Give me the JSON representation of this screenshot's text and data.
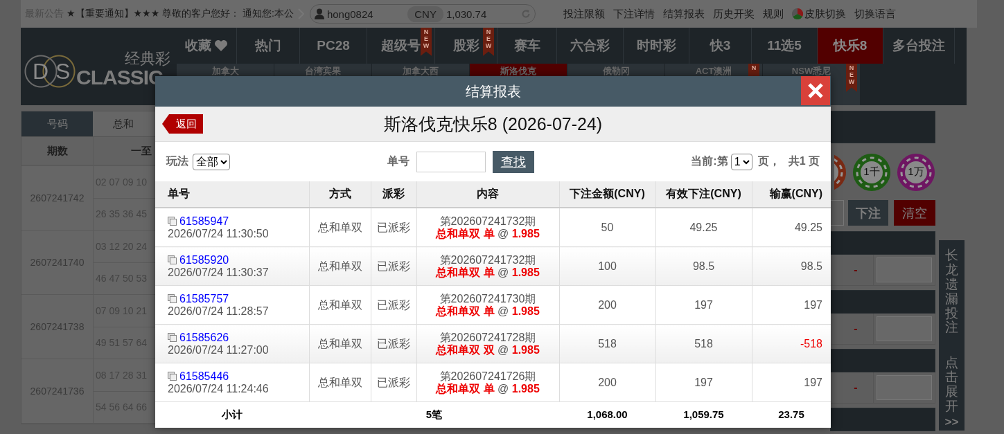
{
  "notice": {
    "label": "最新公告",
    "text": "★【重要通知】★★★ 尊敬的客户您好： 通知您:本公"
  },
  "account": {
    "username": "hong0824",
    "currency": "CNY",
    "balance": "1,030.74"
  },
  "top_links": [
    {
      "label": "投注限额",
      "kind": "link"
    },
    {
      "label": "下注详情",
      "kind": "link"
    },
    {
      "label": "结算报表",
      "kind": "link"
    },
    {
      "label": "历史开奖",
      "kind": "link"
    },
    {
      "label": "规则",
      "kind": "link"
    },
    {
      "label": "皮肤切换",
      "kind": "skin"
    },
    {
      "label": "切换语言",
      "kind": "link"
    }
  ],
  "logo": {
    "monogram": "DS",
    "title": "经典彩",
    "wordmark": "CLASSIC"
  },
  "nav": [
    {
      "label": "收藏",
      "kind": "favorite",
      "selected": false
    },
    {
      "label": "热门",
      "kind": "plain",
      "selected": false
    },
    {
      "label": "PC28",
      "kind": "plain",
      "selected": false
    },
    {
      "label": "超级号",
      "kind": "plain",
      "selected": false,
      "badge": "NEW"
    },
    {
      "label": "股彩",
      "kind": "plain",
      "selected": false,
      "badge": "NEW"
    },
    {
      "label": "赛车",
      "kind": "plain",
      "selected": false
    },
    {
      "label": "六合彩",
      "kind": "plain",
      "selected": false
    },
    {
      "label": "时时彩",
      "kind": "plain",
      "selected": false
    },
    {
      "label": "快3",
      "kind": "plain",
      "selected": false
    },
    {
      "label": "11选5",
      "kind": "plain",
      "selected": false
    },
    {
      "label": "快乐8",
      "kind": "plain",
      "selected": true
    },
    {
      "label": "多台投注",
      "kind": "plain",
      "selected": false
    }
  ],
  "sub_nav": [
    {
      "label": "加拿大",
      "selected": false
    },
    {
      "label": "台湾宾果",
      "selected": false
    },
    {
      "label": "加拿大西",
      "selected": false
    },
    {
      "label": "斯洛伐克",
      "selected": true
    },
    {
      "label": "俄勒冈",
      "selected": false
    },
    {
      "label": "ACT澳洲",
      "selected": false,
      "badge": "N"
    },
    {
      "label": "NSW悉尼",
      "selected": false,
      "badge": "NEW"
    }
  ],
  "history": {
    "tabs": [
      {
        "label": "号码",
        "selected": true
      },
      {
        "label": "总和",
        "selected": false
      }
    ],
    "columns": [
      "期数",
      "一至"
    ],
    "rows": [
      {
        "issue": "2607241742",
        "lines": [
          "02 07 09 10",
          "26 35 36 45"
        ]
      },
      {
        "issue": "2607241740",
        "lines": [
          "03 12 20 24",
          "46 47 50 53"
        ]
      },
      {
        "issue": "2607241738",
        "lines": [
          "07 09 10 21",
          "49 51 57 64"
        ]
      },
      {
        "issue": "2607241736",
        "lines": [
          "08 17 28 31",
          "54 56 64 66"
        ]
      }
    ]
  },
  "bet_panel": {
    "chips": [
      {
        "color": "#7a2a14"
      },
      {
        "label": "1千",
        "color": "#1e5c14"
      },
      {
        "label": "1万",
        "color": "#6e1662"
      }
    ],
    "submit": "下注",
    "clear": "清空",
    "rows": [
      {
        "odds": "-"
      },
      {
        "odds": "-"
      },
      {
        "odds": "-"
      }
    ]
  },
  "side_panel": {
    "title": "长龙遗漏投注",
    "action": "点击展开",
    "arrow": ">>"
  },
  "modal": {
    "title": "结算报表",
    "back": "返回",
    "heading": "斯洛伐克快乐8 (2026-07-24)",
    "filter": {
      "label": "玩法",
      "value": "全部"
    },
    "search": {
      "label": "单号",
      "button": "查找"
    },
    "pager": {
      "before": "当前:第",
      "page": "1",
      "after": "页，",
      "total": "共1 页"
    },
    "columns": [
      "单号",
      "方式",
      "派彩",
      "内容",
      "下注金额(CNY)",
      "有效下注(CNY)",
      "输赢(CNY)"
    ],
    "rows": [
      {
        "order_no": "61585947",
        "time": "2026/07/24 11:30:50",
        "method": "总和单双",
        "payout": "已派彩",
        "period": "第202607241732期",
        "content": "**总和单双 单** @ **1.985**",
        "amount": "50",
        "valid": "49.25",
        "win": "49.25",
        "negative": false
      },
      {
        "order_no": "61585920",
        "time": "2026/07/24 11:30:37",
        "method": "总和单双",
        "payout": "已派彩",
        "period": "第202607241732期",
        "content": "**总和单双 单** @ **1.985**",
        "amount": "100",
        "valid": "98.5",
        "win": "98.5",
        "negative": false
      },
      {
        "order_no": "61585757",
        "time": "2026/07/24 11:28:57",
        "method": "总和单双",
        "payout": "已派彩",
        "period": "第202607241730期",
        "content": "**总和单双 单** @ **1.985**",
        "amount": "200",
        "valid": "197",
        "win": "197",
        "negative": false
      },
      {
        "order_no": "61585626",
        "time": "2026/07/24 11:27:00",
        "method": "总和单双",
        "payout": "已派彩",
        "period": "第202607241728期",
        "content": "**总和单双 双** @ **1.985**",
        "amount": "518",
        "valid": "518",
        "win": "-518",
        "negative": true
      },
      {
        "order_no": "61585446",
        "time": "2026/07/24 11:24:46",
        "method": "总和单双",
        "payout": "已派彩",
        "period": "第202607241726期",
        "content": "**总和单双 单** @ **1.985**",
        "amount": "200",
        "valid": "197",
        "win": "197",
        "negative": false
      }
    ],
    "totals": {
      "label": "小计",
      "count": "5笔",
      "amount": "1,068.00",
      "valid": "1,059.75",
      "win": "23.75"
    }
  }
}
